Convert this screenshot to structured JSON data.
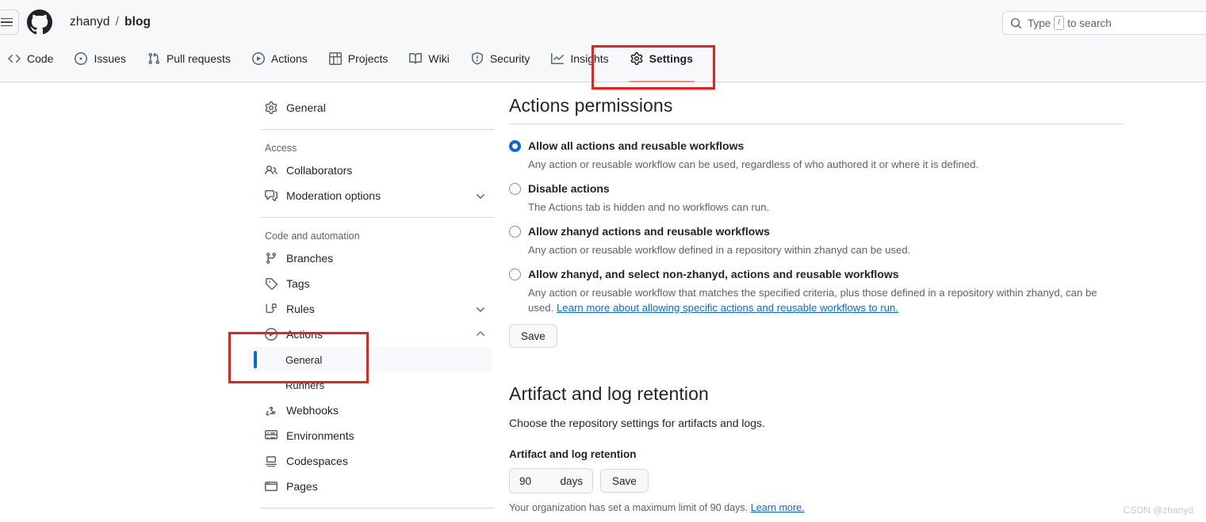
{
  "header": {
    "menu_icon": "hamburger-icon",
    "logo_icon": "github-logo-icon",
    "breadcrumb": {
      "owner": "zhanyd",
      "separator": "/",
      "repo": "blog"
    },
    "search": {
      "icon": "search-icon",
      "placeholder_prefix": "Type",
      "key": "/",
      "placeholder_suffix": "to search"
    }
  },
  "repo_nav": {
    "tabs": [
      {
        "label": "Code",
        "icon": "code-icon",
        "active": false
      },
      {
        "label": "Issues",
        "icon": "issue-opened-icon",
        "active": false
      },
      {
        "label": "Pull requests",
        "icon": "git-pull-request-icon",
        "active": false
      },
      {
        "label": "Actions",
        "icon": "play-icon",
        "active": false
      },
      {
        "label": "Projects",
        "icon": "table-icon",
        "active": false
      },
      {
        "label": "Wiki",
        "icon": "book-icon",
        "active": false
      },
      {
        "label": "Security",
        "icon": "shield-icon",
        "active": false
      },
      {
        "label": "Insights",
        "icon": "graph-icon",
        "active": false
      },
      {
        "label": "Settings",
        "icon": "gear-icon",
        "active": true
      }
    ]
  },
  "sidebar": {
    "general": {
      "label": "General",
      "icon": "gear-icon"
    },
    "sections": [
      {
        "title": "Access",
        "items": [
          {
            "label": "Collaborators",
            "icon": "people-icon",
            "chevron": ""
          },
          {
            "label": "Moderation options",
            "icon": "comment-discussion-icon",
            "chevron": "down"
          }
        ]
      },
      {
        "title": "Code and automation",
        "items": [
          {
            "label": "Branches",
            "icon": "git-branch-icon",
            "chevron": ""
          },
          {
            "label": "Tags",
            "icon": "tag-icon",
            "chevron": ""
          },
          {
            "label": "Rules",
            "icon": "rules-icon",
            "chevron": "down"
          },
          {
            "label": "Actions",
            "icon": "play-icon",
            "chevron": "up",
            "subitems": [
              {
                "label": "General",
                "selected": true
              },
              {
                "label": "Runners",
                "selected": false
              }
            ]
          },
          {
            "label": "Webhooks",
            "icon": "webhook-icon",
            "chevron": ""
          },
          {
            "label": "Environments",
            "icon": "server-icon",
            "chevron": ""
          },
          {
            "label": "Codespaces",
            "icon": "codespaces-icon",
            "chevron": ""
          },
          {
            "label": "Pages",
            "icon": "browser-icon",
            "chevron": ""
          }
        ]
      }
    ]
  },
  "main": {
    "permissions": {
      "heading": "Actions permissions",
      "options": [
        {
          "label": "Allow all actions and reusable workflows",
          "description": "Any action or reusable workflow can be used, regardless of who authored it or where it is defined.",
          "selected": true
        },
        {
          "label": "Disable actions",
          "description": "The Actions tab is hidden and no workflows can run.",
          "selected": false
        },
        {
          "label": "Allow zhanyd actions and reusable workflows",
          "description": "Any action or reusable workflow defined in a repository within zhanyd can be used.",
          "selected": false
        },
        {
          "label": "Allow zhanyd, and select non-zhanyd, actions and reusable workflows",
          "description": "Any action or reusable workflow that matches the specified criteria, plus those defined in a repository within zhanyd, can be used. ",
          "link_text": "Learn more about allowing specific actions and reusable workflows to run.",
          "selected": false
        }
      ],
      "save_label": "Save"
    },
    "retention": {
      "heading": "Artifact and log retention",
      "description": "Choose the repository settings for artifacts and logs.",
      "field_label": "Artifact and log retention",
      "value": "90",
      "unit": "days",
      "save_label": "Save",
      "hint_text": "Your organization has set a maximum limit of 90 days. ",
      "hint_link": "Learn more."
    }
  },
  "annotations": {
    "color": "#e8211c"
  },
  "watermark": "CSDN @zhanyd"
}
